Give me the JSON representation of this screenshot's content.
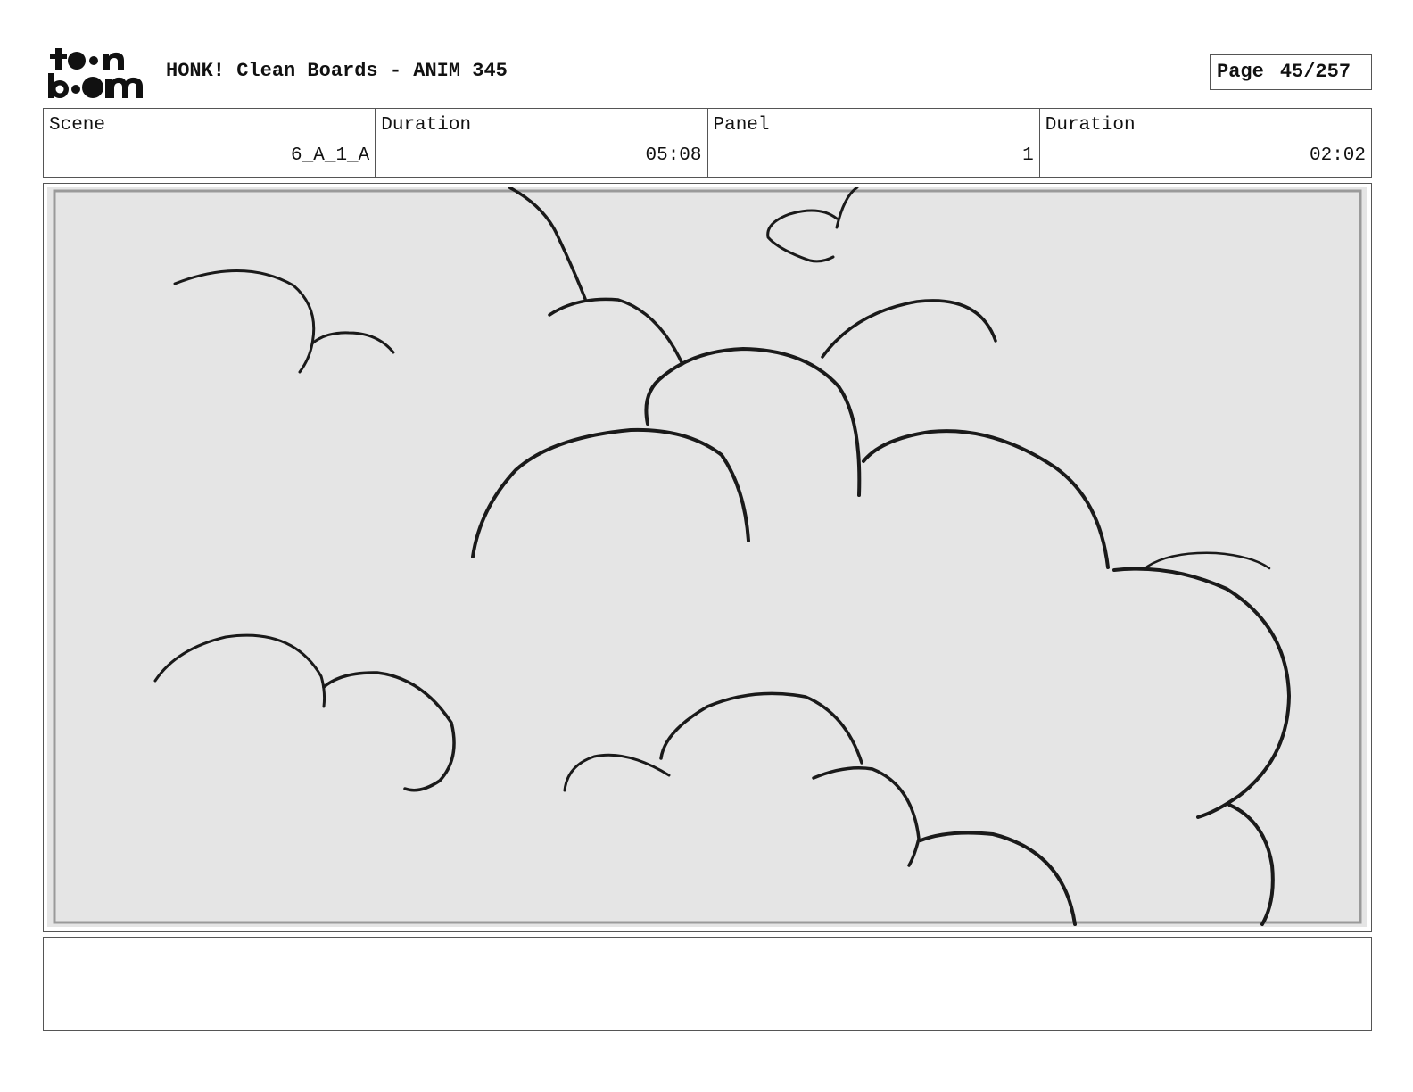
{
  "header": {
    "logo_alt": "toon boom",
    "title": "HONK! Clean Boards - ANIM 345",
    "page_label": "Page",
    "page_number": "45/257"
  },
  "info": {
    "scene_label": "Scene",
    "scene_value": "6_A_1_A",
    "scene_duration_label": "Duration",
    "scene_duration_value": "05:08",
    "panel_label": "Panel",
    "panel_value": "1",
    "panel_duration_label": "Duration",
    "panel_duration_value": "02:02"
  },
  "panel": {
    "background_color": "#e5e5e5",
    "line_color": "#1a1a1a",
    "inner_border_color": "#9a9a9a",
    "drawing_subject": "cloud-outlines"
  },
  "notes": {
    "text": ""
  }
}
